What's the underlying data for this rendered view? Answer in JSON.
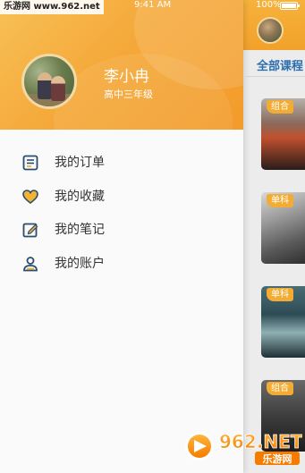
{
  "watermark": {
    "top_text": "乐游网 www.962.net",
    "logo_text": "962.NET",
    "logo_subtext": "乐游网"
  },
  "status_bar": {
    "time": "9:41 AM",
    "battery": "100%"
  },
  "background": {
    "tab_label": "全部课程",
    "cards": [
      {
        "badge": "组合"
      },
      {
        "badge": "单科"
      },
      {
        "badge": "单科"
      },
      {
        "badge": "组合"
      }
    ]
  },
  "drawer": {
    "user": {
      "name": "李小冉",
      "grade": "高中三年级"
    },
    "menu": [
      {
        "label": "我的订单",
        "icon": "order-list-icon"
      },
      {
        "label": "我的收藏",
        "icon": "heart-icon"
      },
      {
        "label": "我的笔记",
        "icon": "note-edit-icon"
      },
      {
        "label": "我的账户",
        "icon": "user-account-icon"
      }
    ]
  },
  "colors": {
    "accent": "#f5a93a",
    "icon_blue": "#2a4d6e",
    "icon_gold": "#f2b233",
    "tab_blue": "#2b6fb0"
  }
}
